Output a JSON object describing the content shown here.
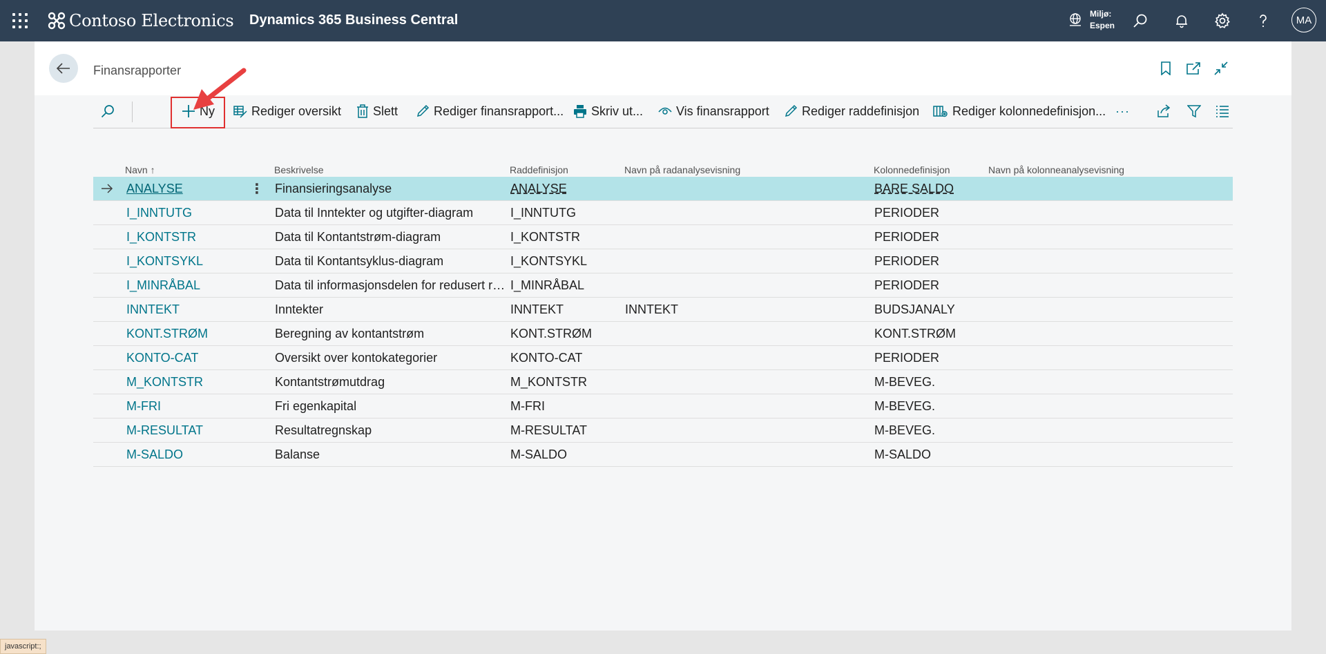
{
  "topbar": {
    "brand": "Contoso Electronics",
    "product": "Dynamics 365 Business Central",
    "env_label": "Miljø:",
    "env_value": "Espen",
    "avatar": "MA"
  },
  "page": {
    "title": "Finansrapporter"
  },
  "actions": {
    "new": "Ny",
    "edit_overview": "Rediger oversikt",
    "delete": "Slett",
    "edit_report": "Rediger finansrapport...",
    "print": "Skriv ut...",
    "view_report": "Vis finansrapport",
    "edit_row_def": "Rediger raddefinisjon",
    "edit_col_def": "Rediger kolonnedefinisjon...",
    "more": "···"
  },
  "table": {
    "columns": {
      "name": "Navn",
      "description": "Beskrivelse",
      "row_def": "Raddefinisjon",
      "row_view": "Navn på radanalysevisning",
      "col_def": "Kolonnedefinisjon",
      "col_view": "Navn på kolonneanalysevisning"
    },
    "sort_indicator": "↑",
    "rows": [
      {
        "name": "ANALYSE",
        "description": "Finansieringsanalyse",
        "row_def": "ANALYSE",
        "row_view": "",
        "col_def": "BARE SALDO",
        "col_view": ""
      },
      {
        "name": "I_INNTUTG",
        "description": "Data til Inntekter og utgifter-diagram",
        "row_def": "I_INNTUTG",
        "row_view": "",
        "col_def": "PERIODER",
        "col_view": ""
      },
      {
        "name": "I_KONTSTR",
        "description": "Data til Kontantstrøm-diagram",
        "row_def": "I_KONTSTR",
        "row_view": "",
        "col_def": "PERIODER",
        "col_view": ""
      },
      {
        "name": "I_KONTSYKL",
        "description": "Data til Kontantsyklus-diagram",
        "row_def": "I_KONTSYKL",
        "row_view": "",
        "col_def": "PERIODER",
        "col_view": ""
      },
      {
        "name": "I_MINRÅBAL",
        "description": "Data til informasjonsdelen for redusert rå...",
        "row_def": "I_MINRÅBAL",
        "row_view": "",
        "col_def": "PERIODER",
        "col_view": ""
      },
      {
        "name": "INNTEKT",
        "description": "Inntekter",
        "row_def": "INNTEKT",
        "row_view": "INNTEKT",
        "col_def": "BUDSJANALY",
        "col_view": ""
      },
      {
        "name": "KONT.STRØM",
        "description": "Beregning av kontantstrøm",
        "row_def": "KONT.STRØM",
        "row_view": "",
        "col_def": "KONT.STRØM",
        "col_view": ""
      },
      {
        "name": "KONTO-CAT",
        "description": "Oversikt over kontokategorier",
        "row_def": "KONTO-CAT",
        "row_view": "",
        "col_def": "PERIODER",
        "col_view": ""
      },
      {
        "name": "M_KONTSTR",
        "description": "Kontantstrømutdrag",
        "row_def": "M_KONTSTR",
        "row_view": "",
        "col_def": "M-BEVEG.",
        "col_view": ""
      },
      {
        "name": "M-FRI",
        "description": "Fri egenkapital",
        "row_def": "M-FRI",
        "row_view": "",
        "col_def": "M-BEVEG.",
        "col_view": ""
      },
      {
        "name": "M-RESULTAT",
        "description": "Resultatregnskap",
        "row_def": "M-RESULTAT",
        "row_view": "",
        "col_def": "M-BEVEG.",
        "col_view": ""
      },
      {
        "name": "M-SALDO",
        "description": "Balanse",
        "row_def": "M-SALDO",
        "row_view": "",
        "col_def": "M-SALDO",
        "col_view": ""
      }
    ]
  },
  "status_bar": "javascript:;",
  "colors": {
    "topbar": "#2f4155",
    "accent": "#00758a",
    "selected_row": "#b3e3e8",
    "highlight": "#e03030"
  }
}
